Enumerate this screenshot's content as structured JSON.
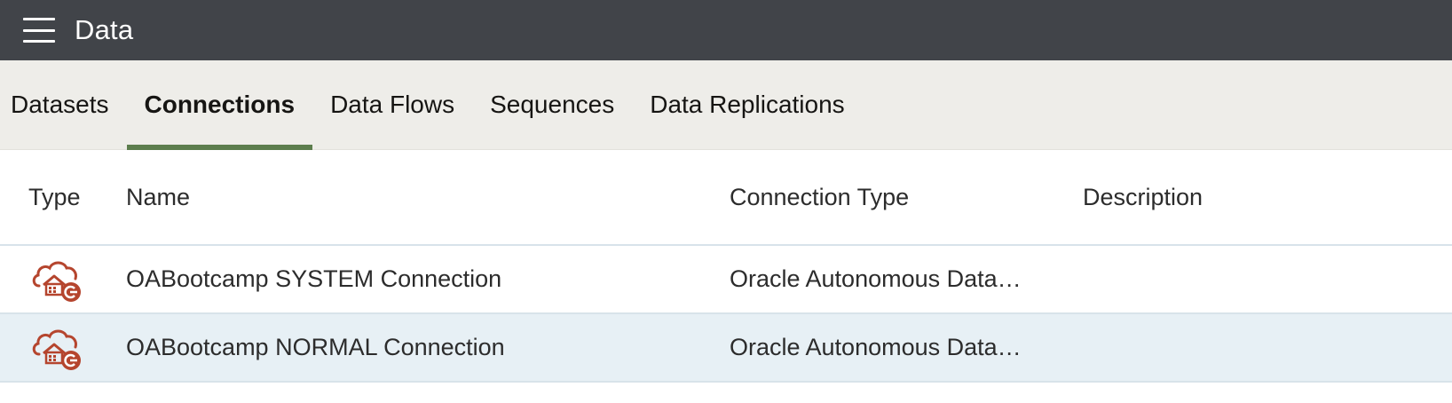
{
  "header": {
    "title": "Data",
    "menu_icon": "hamburger-menu-icon"
  },
  "tabs": [
    {
      "label": "Datasets",
      "active": false
    },
    {
      "label": "Connections",
      "active": true
    },
    {
      "label": "Data Flows",
      "active": false
    },
    {
      "label": "Sequences",
      "active": false
    },
    {
      "label": "Data Replications",
      "active": false
    }
  ],
  "table": {
    "columns": [
      "Type",
      "Name",
      "Connection Type",
      "Description"
    ],
    "rows": [
      {
        "type_icon": "oracle-autonomous-database-icon",
        "name": "OABootcamp SYSTEM Connection",
        "connection_type": "Oracle Autonomous Data…",
        "description": "",
        "selected": false
      },
      {
        "type_icon": "oracle-autonomous-database-icon",
        "name": "OABootcamp NORMAL Connection",
        "connection_type": "Oracle Autonomous Data…",
        "description": "",
        "selected": true
      }
    ]
  },
  "colors": {
    "topbar": "#414449",
    "tab_bar": "#eeede9",
    "active_tab_underline": "#5c7d4d",
    "icon_red": "#b5452e",
    "selected_row": "#e7f0f5"
  }
}
